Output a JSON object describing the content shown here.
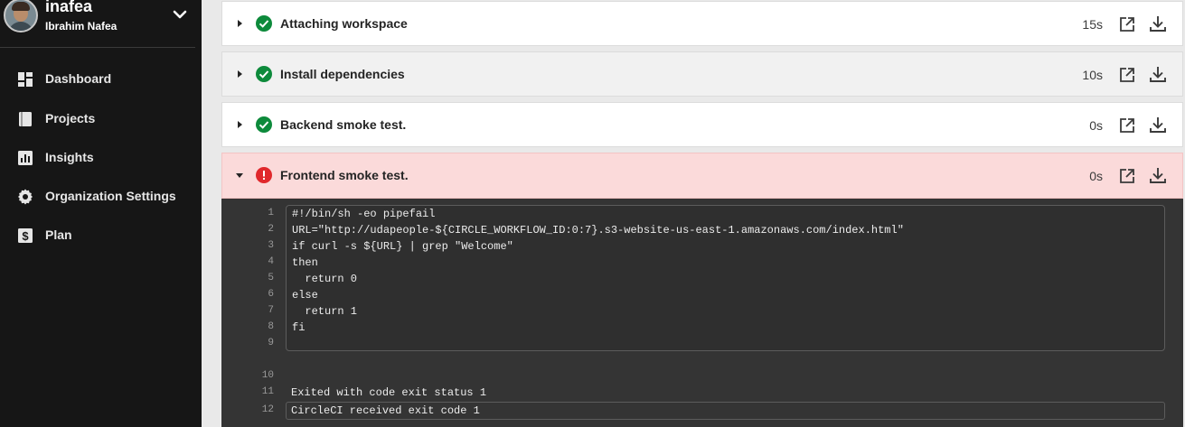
{
  "sidebar": {
    "org_name": "inafea",
    "user_name": "Ibrahim Nafea",
    "items": [
      {
        "label": "Dashboard",
        "icon": "dashboard-icon"
      },
      {
        "label": "Projects",
        "icon": "projects-icon"
      },
      {
        "label": "Insights",
        "icon": "insights-icon"
      },
      {
        "label": "Organization Settings",
        "icon": "gear-icon"
      },
      {
        "label": "Plan",
        "icon": "plan-dollar-icon"
      }
    ]
  },
  "steps": [
    {
      "name": "Attaching workspace",
      "duration": "15s",
      "status": "success"
    },
    {
      "name": "Install dependencies",
      "duration": "10s",
      "status": "success"
    },
    {
      "name": "Backend smoke test.",
      "duration": "0s",
      "status": "success"
    },
    {
      "name": "Frontend smoke test.",
      "duration": "0s",
      "status": "failed"
    }
  ],
  "terminal": {
    "lines": [
      {
        "n": "1",
        "text": "#!/bin/sh -eo pipefail"
      },
      {
        "n": "2",
        "text": "URL=\"http://udapeople-${CIRCLE_WORKFLOW_ID:0:7}.s3-website-us-east-1.amazonaws.com/index.html\""
      },
      {
        "n": "3",
        "text": "if curl -s ${URL} | grep \"Welcome\""
      },
      {
        "n": "4",
        "text": "then"
      },
      {
        "n": "5",
        "text": "  return 0"
      },
      {
        "n": "6",
        "text": "else"
      },
      {
        "n": "7",
        "text": "  return 1"
      },
      {
        "n": "8",
        "text": "fi"
      },
      {
        "n": "9",
        "text": ""
      },
      {
        "n": "10",
        "text": ""
      },
      {
        "n": "11",
        "text": "Exited with code exit status 1"
      },
      {
        "n": "12",
        "text": "CircleCI received exit code 1"
      }
    ]
  },
  "colors": {
    "success": "#0d8a3b",
    "failed": "#e0282c",
    "failed_bg": "#fbdada",
    "sidebar_bg": "#161616",
    "terminal_bg": "#343434"
  }
}
